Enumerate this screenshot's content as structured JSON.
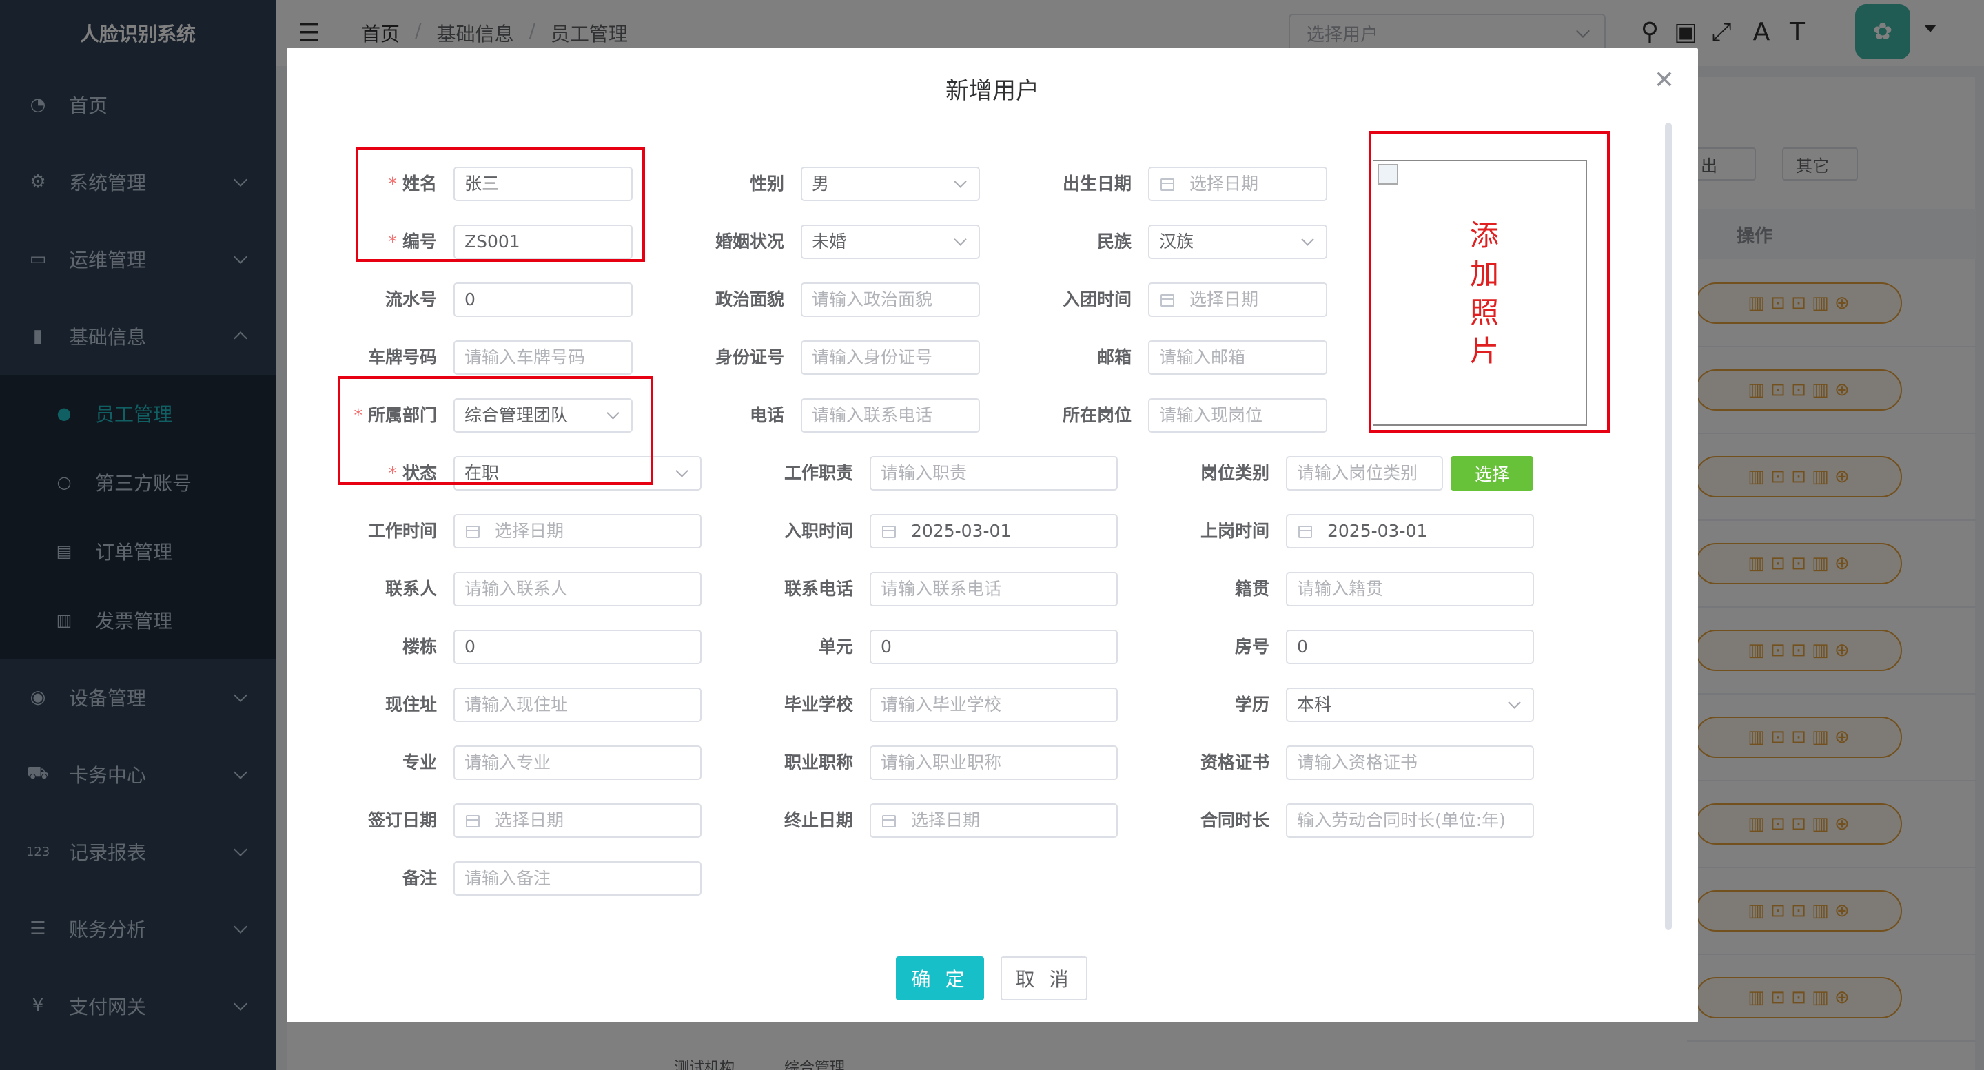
{
  "app": {
    "title": "人脸识别系统"
  },
  "sidebar": {
    "items": [
      {
        "label": "首页",
        "icon": "dashboard-icon"
      },
      {
        "label": "系统管理",
        "icon": "gear-icon"
      },
      {
        "label": "运维管理",
        "icon": "monitor-icon"
      },
      {
        "label": "基础信息",
        "icon": "bar-chart-icon"
      }
    ],
    "sub_items": [
      {
        "label": "员工管理",
        "icon": "users-icon",
        "active": true
      },
      {
        "label": "第三方账号",
        "icon": "user-icon"
      },
      {
        "label": "订单管理",
        "icon": "list-icon"
      },
      {
        "label": "发票管理",
        "icon": "book-icon"
      }
    ],
    "more_items": [
      {
        "label": "设备管理",
        "icon": "circle-dot-icon"
      },
      {
        "label": "卡务中心",
        "icon": "cart-icon"
      },
      {
        "label": "记录报表",
        "icon": "number-icon"
      },
      {
        "label": "账务分析",
        "icon": "list-ordered-icon"
      },
      {
        "label": "支付网关",
        "icon": "yen-icon"
      }
    ]
  },
  "header": {
    "breadcrumb": [
      "首页",
      "基础信息",
      "员工管理"
    ],
    "user_select_placeholder": "选择用户"
  },
  "background": {
    "export_label": "出",
    "other_label": "其它",
    "column_header": "操作",
    "cell_1": "测试机构",
    "cell_2": "综合管理"
  },
  "dialog": {
    "title": "新增用户",
    "photo_label": "添加照片",
    "select_button": "选择",
    "confirm": "确 定",
    "cancel": "取 消",
    "fields": {
      "name": {
        "label": "姓名",
        "value": "张三"
      },
      "gender": {
        "label": "性别",
        "value": "男"
      },
      "birth_date": {
        "label": "出生日期",
        "placeholder": "选择日期"
      },
      "code": {
        "label": "编号",
        "value": "ZS001"
      },
      "marital": {
        "label": "婚姻状况",
        "value": "未婚"
      },
      "ethnic": {
        "label": "民族",
        "value": "汉族"
      },
      "serial": {
        "label": "流水号",
        "value": "0"
      },
      "political": {
        "label": "政治面貌",
        "placeholder": "请输入政治面貌"
      },
      "league_date": {
        "label": "入团时间",
        "placeholder": "选择日期"
      },
      "plate": {
        "label": "车牌号码",
        "placeholder": "请输入车牌号码"
      },
      "id_card": {
        "label": "身份证号",
        "placeholder": "请输入身份证号"
      },
      "email": {
        "label": "邮箱",
        "placeholder": "请输入邮箱"
      },
      "department": {
        "label": "所属部门",
        "value": "综合管理团队"
      },
      "phone": {
        "label": "电话",
        "placeholder": "请输入联系电话"
      },
      "post": {
        "label": "所在岗位",
        "placeholder": "请输入现岗位"
      },
      "status": {
        "label": "状态",
        "value": "在职"
      },
      "duty": {
        "label": "工作职责",
        "placeholder": "请输入职责"
      },
      "post_type": {
        "label": "岗位类别",
        "placeholder": "请输入岗位类别"
      },
      "work_time": {
        "label": "工作时间",
        "placeholder": "选择日期"
      },
      "join_date": {
        "label": "入职时间",
        "value": "2025-03-01"
      },
      "onboard_date": {
        "label": "上岗时间",
        "value": "2025-03-01"
      },
      "contact": {
        "label": "联系人",
        "placeholder": "请输入联系人"
      },
      "contact_phone": {
        "label": "联系电话",
        "placeholder": "请输入联系电话"
      },
      "native": {
        "label": "籍贯",
        "placeholder": "请输入籍贯"
      },
      "building": {
        "label": "楼栋",
        "value": "0"
      },
      "unit": {
        "label": "单元",
        "value": "0"
      },
      "room": {
        "label": "房号",
        "value": "0"
      },
      "address": {
        "label": "现住址",
        "placeholder": "请输入现住址"
      },
      "school": {
        "label": "毕业学校",
        "placeholder": "请输入毕业学校"
      },
      "education": {
        "label": "学历",
        "value": "本科"
      },
      "major": {
        "label": "专业",
        "placeholder": "请输入专业"
      },
      "title": {
        "label": "职业职称",
        "placeholder": "请输入职业职称"
      },
      "certificate": {
        "label": "资格证书",
        "placeholder": "请输入资格证书"
      },
      "sign_date": {
        "label": "签订日期",
        "placeholder": "选择日期"
      },
      "end_date": {
        "label": "终止日期",
        "placeholder": "选择日期"
      },
      "contract_years": {
        "label": "合同时长",
        "placeholder": "输入劳动合同时长(单位:年)"
      },
      "remark": {
        "label": "备注",
        "placeholder": "请输入备注"
      }
    }
  },
  "colors": {
    "sidebar_bg": "#304156",
    "accent": "#17bfc9",
    "highlight_box": "#e60012",
    "select_button": "#67c23a"
  }
}
